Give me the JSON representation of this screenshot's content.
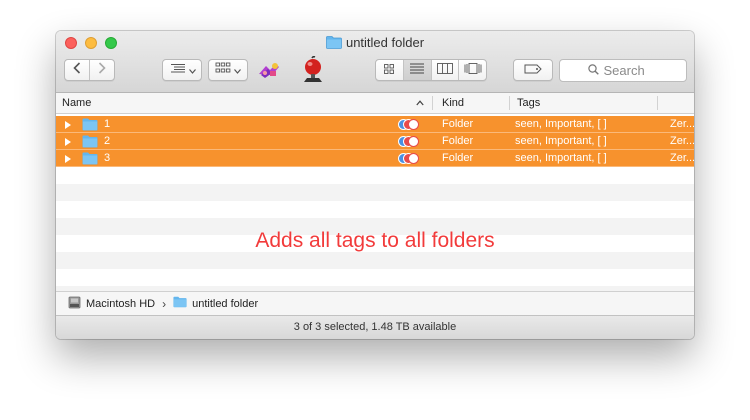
{
  "window": {
    "title": "untitled folder"
  },
  "toolbar": {
    "search_placeholder": "Search"
  },
  "columns": {
    "name": "Name",
    "kind": "Kind",
    "tags": "Tags"
  },
  "rows": [
    {
      "name": "1",
      "kind": "Folder",
      "tags": "seen, Important, [ ]",
      "extra": "Zer..."
    },
    {
      "name": "2",
      "kind": "Folder",
      "tags": "seen, Important, [ ]",
      "extra": "Zer..."
    },
    {
      "name": "3",
      "kind": "Folder",
      "tags": "seen, Important, [ ]",
      "extra": "Zer..."
    }
  ],
  "annotation": "Adds all tags to all folders",
  "pathbar": {
    "volume": "Macintosh HD",
    "folder": "untitled folder"
  },
  "status": "3 of 3 selected, 1.48 TB available",
  "colors": {
    "selection": "#f7922d",
    "annotation": "#f23b3b",
    "folder": "#63b6ee"
  },
  "icons": {
    "view_modes": [
      "icon-view-icon",
      "list-view-icon",
      "column-view-icon",
      "cover-flow-icon"
    ]
  }
}
